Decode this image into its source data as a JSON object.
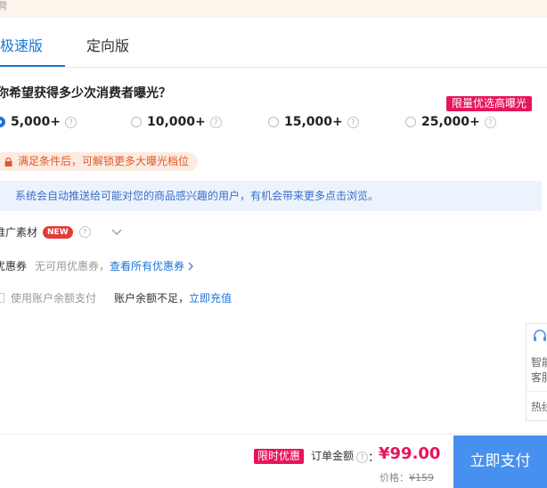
{
  "banner": {
    "fragment": "荷"
  },
  "tabs": [
    {
      "label": "极速版",
      "active": true
    },
    {
      "label": "定向版",
      "active": false
    }
  ],
  "question": "你希望获得多少次消费者曝光？",
  "promo_badge": "限量优选高曝光",
  "options": [
    {
      "label": "5,000+",
      "selected": true
    },
    {
      "label": "10,000+",
      "selected": false
    },
    {
      "label": "15,000+",
      "selected": false
    },
    {
      "label": "25,000+",
      "selected": false
    }
  ],
  "help_glyph": "?",
  "unlock_tip": "满足条件后，可解锁更多大曝光档位",
  "info_text": "系统会自动推送给可能对您的商品感兴趣的用户，有机会带来更多点击浏览。",
  "material": {
    "label": "推广素材",
    "badge": "NEW"
  },
  "coupon": {
    "label": "优惠券",
    "none_text": "无可用优惠券，",
    "link_text": "查看所有优惠券"
  },
  "balance": {
    "checkbox_label": "使用账户余额支付",
    "insufficient": "账户余额不足，",
    "recharge_link": "立即充值"
  },
  "side_widget": {
    "line1": "智能",
    "line2": "客服",
    "line3": "热线"
  },
  "footer": {
    "limit_badge": "限时优惠",
    "amount_label": "订单金额",
    "colon": "：",
    "amount": "¥99.00",
    "price_label": "价格：",
    "original_price": "¥159",
    "pay_button": "立即支付"
  },
  "colors": {
    "accent": "#1b74d8",
    "price": "#e8145d",
    "pay_button": "#4790ef"
  }
}
